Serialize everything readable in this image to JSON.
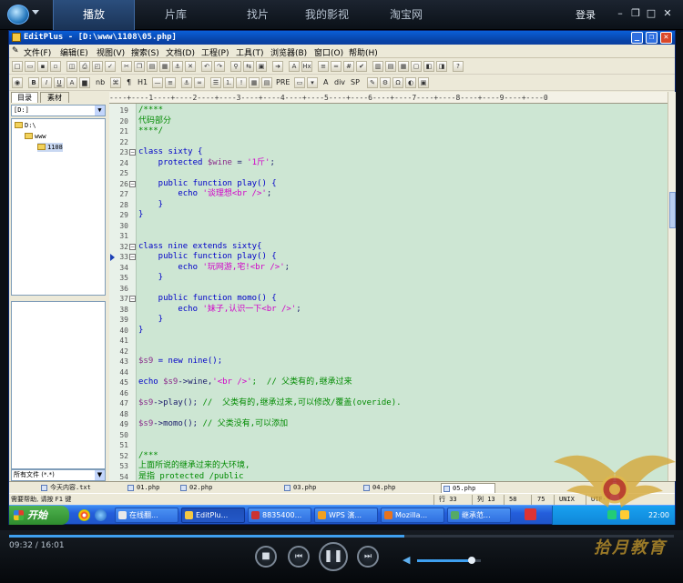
{
  "player": {
    "tabs": [
      "播放",
      "片库",
      "找片",
      "我的影视",
      "淘宝网"
    ],
    "active_tab": "播放",
    "login_label": "登录",
    "window_controls": [
      "minimize-icon",
      "restore-icon",
      "maximize-icon",
      "close-icon"
    ],
    "elapsed": "09:32",
    "duration": "16:01",
    "time_display": "09:32 / 16:01",
    "progress_fraction": 0.594,
    "volume_fraction": 0.85,
    "controls": [
      "stop-icon",
      "previous-icon",
      "pause-icon",
      "next-icon",
      "volume-icon"
    ]
  },
  "app": {
    "title": "EditPlus - [D:\\www\\1108\\05.php]",
    "menus": [
      "文件(F)",
      "编辑(E)",
      "视图(V)",
      "搜索(S)",
      "文档(D)",
      "工程(P)",
      "工具(T)",
      "浏览器(B)",
      "窗口(O)",
      "帮助(H)"
    ]
  },
  "sidebar": {
    "tabs": [
      "目录",
      "素材"
    ],
    "drive": "[D:]",
    "tree": [
      "D:\\",
      "www",
      "1108"
    ],
    "selected_folder": "1108",
    "file_filter": "所有文件 (*.*)"
  },
  "editor": {
    "ruler": "----+----1----+----2----+----3----+----4----+----5----+----6----+----7----+----8----+----9----+----0",
    "lines": [
      {
        "n": "19",
        "segments": [
          {
            "t": "/****",
            "c": "cmt"
          }
        ]
      },
      {
        "n": "20",
        "segments": [
          {
            "t": "代码部分",
            "c": "cmt"
          }
        ]
      },
      {
        "n": "21",
        "segments": [
          {
            "t": "****/",
            "c": "cmt"
          }
        ]
      },
      {
        "n": "22",
        "segments": []
      },
      {
        "n": "23",
        "fold": true,
        "segments": [
          {
            "t": "class sixty {",
            "c": "kw"
          }
        ]
      },
      {
        "n": "24",
        "segments": [
          {
            "t": "    protected ",
            "c": "kw"
          },
          {
            "t": "$wine",
            "c": "var"
          },
          {
            "t": " = ",
            "c": "plain"
          },
          {
            "t": "'1斤'",
            "c": "str"
          },
          {
            "t": ";",
            "c": "plain"
          }
        ]
      },
      {
        "n": "25",
        "segments": []
      },
      {
        "n": "26",
        "fold": true,
        "segments": [
          {
            "t": "    public function play() {",
            "c": "kw"
          }
        ]
      },
      {
        "n": "27",
        "segments": [
          {
            "t": "        echo ",
            "c": "kw"
          },
          {
            "t": "'谈理想<br />'",
            "c": "str"
          },
          {
            "t": ";",
            "c": "plain"
          }
        ]
      },
      {
        "n": "28",
        "segments": [
          {
            "t": "    }",
            "c": "kw"
          }
        ]
      },
      {
        "n": "29",
        "segments": [
          {
            "t": "}",
            "c": "kw"
          }
        ]
      },
      {
        "n": "30",
        "segments": []
      },
      {
        "n": "31",
        "segments": []
      },
      {
        "n": "32",
        "fold": true,
        "segments": [
          {
            "t": "class nine extends sixty{",
            "c": "kw"
          }
        ]
      },
      {
        "n": "33",
        "fold": true,
        "current": true,
        "segments": [
          {
            "t": "    public function play() {",
            "c": "kw"
          }
        ]
      },
      {
        "n": "34",
        "segments": [
          {
            "t": "        echo ",
            "c": "kw"
          },
          {
            "t": "'玩网游,宅!<br />'",
            "c": "str"
          },
          {
            "t": ";",
            "c": "plain"
          }
        ]
      },
      {
        "n": "35",
        "segments": [
          {
            "t": "    }",
            "c": "kw"
          }
        ]
      },
      {
        "n": "36",
        "segments": []
      },
      {
        "n": "37",
        "fold": true,
        "segments": [
          {
            "t": "    public function momo() {",
            "c": "kw"
          }
        ]
      },
      {
        "n": "38",
        "segments": [
          {
            "t": "        echo ",
            "c": "kw"
          },
          {
            "t": "'妹子,认识一下<br />'",
            "c": "str"
          },
          {
            "t": ";",
            "c": "plain"
          }
        ]
      },
      {
        "n": "39",
        "segments": [
          {
            "t": "    }",
            "c": "kw"
          }
        ]
      },
      {
        "n": "40",
        "segments": [
          {
            "t": "}",
            "c": "kw"
          }
        ]
      },
      {
        "n": "41",
        "segments": []
      },
      {
        "n": "42",
        "segments": []
      },
      {
        "n": "43",
        "segments": [
          {
            "t": "$s9",
            "c": "var"
          },
          {
            "t": " = new nine();",
            "c": "kw"
          }
        ]
      },
      {
        "n": "44",
        "segments": []
      },
      {
        "n": "45",
        "segments": [
          {
            "t": "echo ",
            "c": "kw"
          },
          {
            "t": "$s9",
            "c": "var"
          },
          {
            "t": "->wine,",
            "c": "plain"
          },
          {
            "t": "'<br />'",
            "c": "str"
          },
          {
            "t": ";  // 父类有的,继承过来",
            "c": "cmt"
          }
        ]
      },
      {
        "n": "46",
        "segments": []
      },
      {
        "n": "47",
        "segments": [
          {
            "t": "$s9",
            "c": "var"
          },
          {
            "t": "->play(); ",
            "c": "plain"
          },
          {
            "t": "//  父类有的,继承过来,可以修改/覆盖(overide).",
            "c": "cmt"
          }
        ]
      },
      {
        "n": "48",
        "segments": []
      },
      {
        "n": "49",
        "segments": [
          {
            "t": "$s9",
            "c": "var"
          },
          {
            "t": "->momo(); ",
            "c": "plain"
          },
          {
            "t": "// 父类没有,可以添加",
            "c": "cmt"
          }
        ]
      },
      {
        "n": "50",
        "segments": []
      },
      {
        "n": "51",
        "segments": []
      },
      {
        "n": "52",
        "segments": [
          {
            "t": "/***",
            "c": "cmt"
          }
        ]
      },
      {
        "n": "53",
        "segments": [
          {
            "t": "上面所说的继承过来的大环境,",
            "c": "cmt"
          }
        ]
      },
      {
        "n": "54",
        "segments": [
          {
            "t": "是指 protected /public",
            "c": "cmt"
          }
        ]
      }
    ]
  },
  "doc_tabs": [
    "今天内容.txt",
    "01.php",
    "02.php",
    "03.php",
    "04.php",
    "05.php"
  ],
  "active_doc_tab": "05.php",
  "status": {
    "help": "需要帮助, 请按 F1 键",
    "row": "行 33",
    "col": "列 13",
    "chars": "58",
    "num": "75",
    "format": "UNIX",
    "encoding": "UTF-8"
  },
  "taskbar": {
    "start_label": "开始",
    "tasks": [
      "在线翻...",
      "EditPlu...",
      "8835400...",
      "WPS 演...",
      "Mozilla...",
      "继承范..."
    ],
    "active_task": "EditPlu...",
    "clock": "22:00"
  },
  "watermark": {
    "text": "拾月教育"
  },
  "colors": {
    "editor_bg": "#cde6d3",
    "keyword": "#0000c8",
    "string": "#d100c8",
    "comment": "#008a00",
    "player_accent": "#3fa0f0",
    "xp_title": "#0a5fd8"
  }
}
